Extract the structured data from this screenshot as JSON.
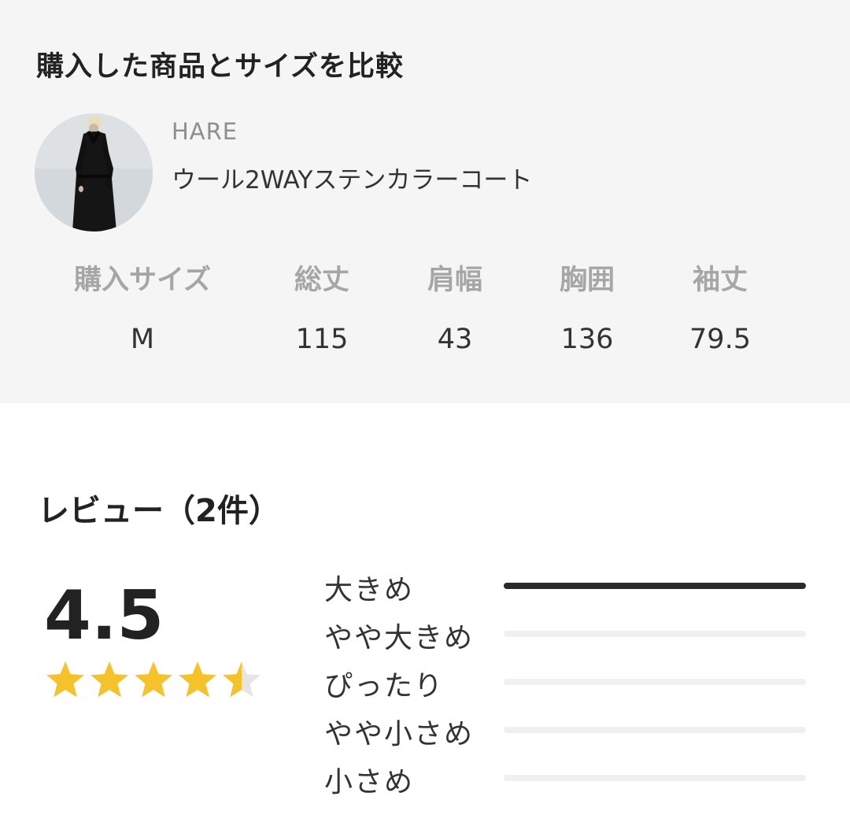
{
  "compare": {
    "title": "購入した商品とサイズを比較",
    "brand": "HARE",
    "product_name": "ウール2WAYステンカラーコート",
    "size_headers": [
      "購入サイズ",
      "総丈",
      "肩幅",
      "胸囲",
      "袖丈"
    ],
    "size_values": [
      "M",
      "115",
      "43",
      "136",
      "79.5"
    ]
  },
  "reviews": {
    "title": "レビュー（2件）",
    "rating": "4.5",
    "rating_value": 4.5,
    "rating_max": 5,
    "star_color": "#f6c22a",
    "star_empty_color": "#e5e5e5",
    "fit": [
      {
        "label": "大きめ",
        "ratio": 1.0
      },
      {
        "label": "やや大きめ",
        "ratio": 0
      },
      {
        "label": "ぴったり",
        "ratio": 0
      },
      {
        "label": "やや小さめ",
        "ratio": 0
      },
      {
        "label": "小さめ",
        "ratio": 0
      }
    ]
  },
  "colors": {
    "section_bg": "#f5f5f5",
    "bar_fill": "#2a2a2e",
    "bar_track": "#f0f0f0"
  }
}
